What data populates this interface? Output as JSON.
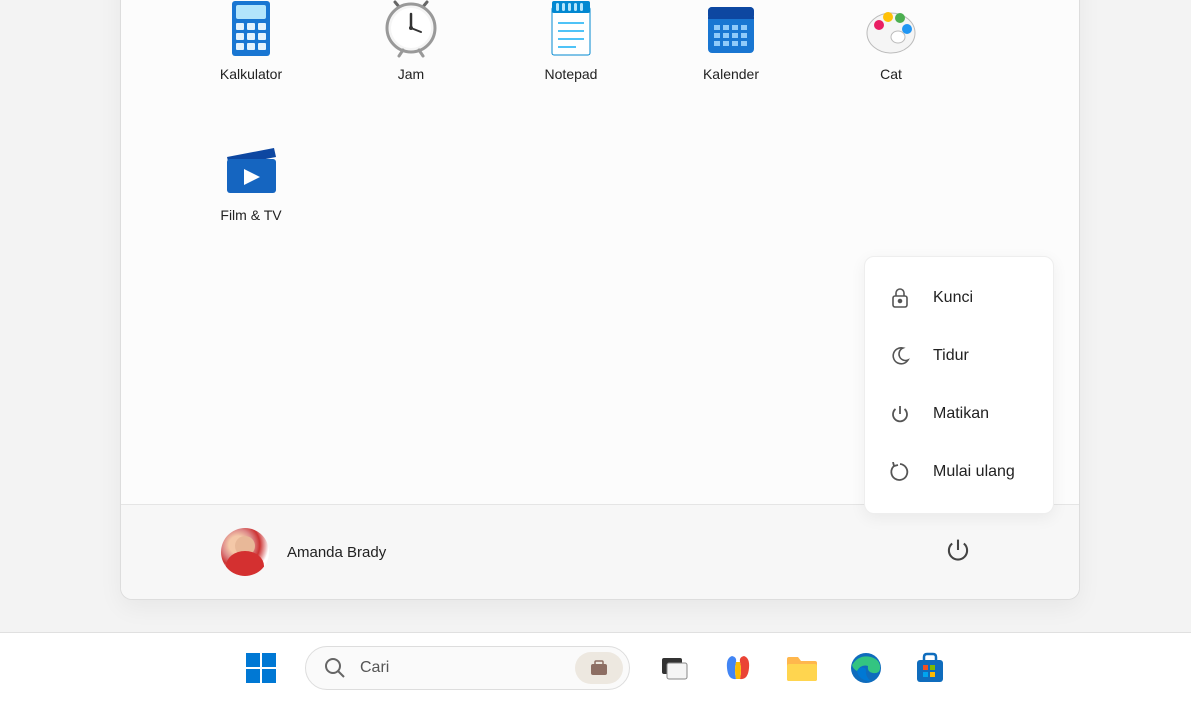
{
  "start_menu": {
    "apps": [
      {
        "name": "Kalkulator",
        "icon": "calculator"
      },
      {
        "name": "Jam",
        "icon": "clock"
      },
      {
        "name": "Notepad",
        "icon": "notepad"
      },
      {
        "name": "Kalender",
        "icon": "calendar"
      },
      {
        "name": "Cat",
        "icon": "paint"
      },
      {
        "name": "Film &amp; TV",
        "icon": "film"
      }
    ],
    "user": "Amanda Brady",
    "power_menu": [
      {
        "label": "Kunci",
        "icon": "lock"
      },
      {
        "label": "Tidur",
        "icon": "sleep"
      },
      {
        "label": "Matikan",
        "icon": "power"
      },
      {
        "label": "Mulai ulang",
        "icon": "restart"
      }
    ]
  },
  "taskbar": {
    "search_placeholder": "Cari",
    "items": [
      {
        "icon": "start"
      },
      {
        "icon": "search"
      },
      {
        "icon": "taskview"
      },
      {
        "icon": "copilot"
      },
      {
        "icon": "explorer"
      },
      {
        "icon": "edge"
      },
      {
        "icon": "store"
      }
    ]
  }
}
